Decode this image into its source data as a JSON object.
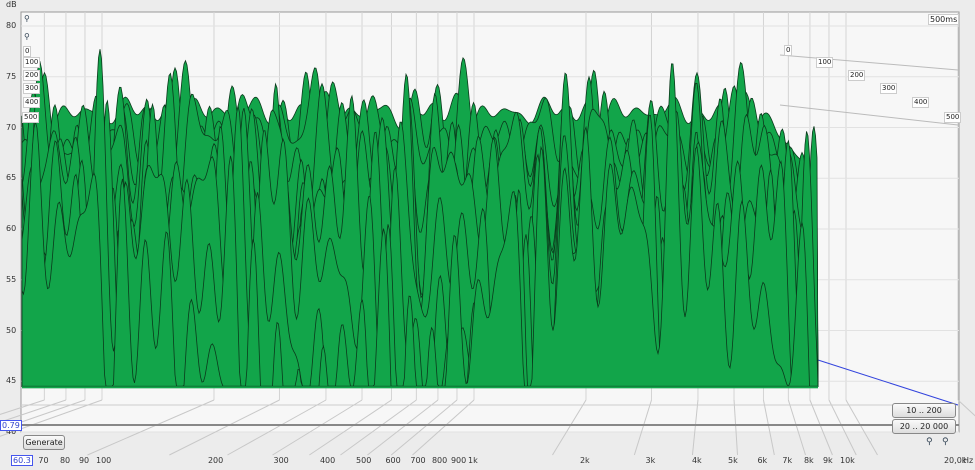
{
  "chart_data": {
    "type": "waterfall",
    "ylabel": "dB",
    "xunit": "Hz",
    "y_ticks": [
      80,
      75,
      70,
      65,
      60,
      55,
      50,
      45,
      40
    ],
    "ylim": [
      40,
      81
    ],
    "x_scale": "log",
    "xlim": [
      60.3,
      20000
    ],
    "x_ticks": [
      "70",
      "80",
      "90",
      "100",
      "200",
      "300",
      "400",
      "500",
      "600",
      "700",
      "800",
      "900",
      "1k",
      "2k",
      "3k",
      "4k",
      "5k",
      "6k",
      "7k",
      "8k",
      "9k",
      "10k",
      "20,0k"
    ],
    "x_tick_values": [
      70,
      80,
      90,
      100,
      200,
      300,
      400,
      500,
      600,
      700,
      800,
      900,
      1000,
      2000,
      3000,
      4000,
      5000,
      6000,
      7000,
      8000,
      9000,
      10000,
      20000
    ],
    "time_labels": [
      "0",
      "100",
      "200",
      "300",
      "400",
      "500"
    ],
    "time_max_label": "500ms",
    "fill_color": "#12a54a",
    "line_color": "#0b3a1c",
    "approx_front_envelope_db": {
      "100": 70,
      "150": 71,
      "300": 72,
      "500": 72,
      "1000": 71,
      "3000": 70,
      "6000": 70,
      "8000": 62,
      "9500": 45
    },
    "floor_db": 44.5
  },
  "cursor": {
    "y_value": "0.79",
    "x_value": "60.3"
  },
  "buttons": {
    "generate": "Generate",
    "range_low": "10 .. 200",
    "range_full": "20 .. 20 000"
  },
  "icons": [
    "zoom-in-icon",
    "zoom-out-icon"
  ]
}
